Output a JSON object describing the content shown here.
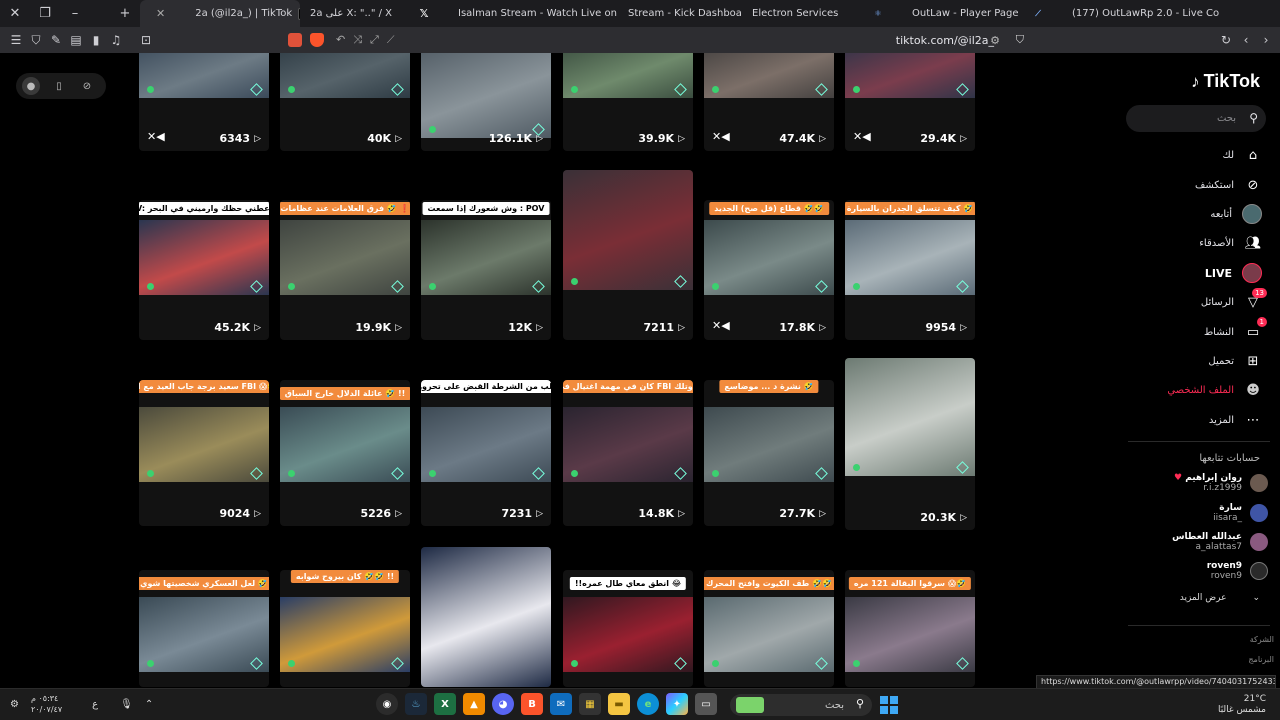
{
  "browser": {
    "tabs": [
      {
        "label": "2a (@il2a_) | TikTok",
        "favicon": "tiktok-icon",
        "active": true
      },
      {
        "label": "2a على X: \"..\" / X",
        "favicon": "x-icon",
        "active": false
      },
      {
        "label": "Isalman Stream - Watch Live on Kick",
        "favicon": "kick-icon",
        "active": false
      },
      {
        "label": "Stream - Kick Dashboard",
        "favicon": "kick-icon",
        "active": false
      },
      {
        "label": "Electron Services",
        "favicon": "electron-icon",
        "active": false
      },
      {
        "label": "OutLaw - Player Page",
        "favicon": "outlaw-icon",
        "active": false
      },
      {
        "label": "(177) OutLawRp 2.0 - Live Console",
        "favicon": "kick-icon",
        "active": false
      }
    ],
    "address": "tiktok.com/@il2a_",
    "status_url": "https://www.tiktok.com/@outlawrpp/video/7404031752433405192"
  },
  "sidebar": {
    "logo": "TikTok",
    "search_placeholder": "بحث",
    "nav": [
      {
        "label": "لك",
        "icon": "home-icon"
      },
      {
        "label": "استكشف",
        "icon": "compass-icon"
      },
      {
        "label": "أتابعه",
        "icon": "avatar-icon"
      },
      {
        "label": "الأصدقاء",
        "icon": "friends-icon"
      },
      {
        "label": "LIVE",
        "icon": "live-avatar-icon"
      },
      {
        "label": "الرسائل",
        "icon": "inbox-icon",
        "badge": "13"
      },
      {
        "label": "النشاط",
        "icon": "activity-icon",
        "badge": "1"
      },
      {
        "label": "تحميل",
        "icon": "upload-icon"
      },
      {
        "label": "الملف الشخصي",
        "icon": "profile-icon"
      },
      {
        "label": "المزيد",
        "icon": "more-icon"
      }
    ],
    "following_title": "حسابات تتابعها",
    "following": [
      {
        "name": "روان إبراهيم",
        "handle": "r.i.z1999",
        "heart": true
      },
      {
        "name": "سارة",
        "handle": "iisara_"
      },
      {
        "name": "عبدالله العطاس",
        "handle": "a_alattas7"
      },
      {
        "name": "roven9",
        "handle": "roven9"
      }
    ],
    "see_more": "عرض المزيد",
    "footer": [
      "الشركة",
      "البرنامج"
    ]
  },
  "videos": [
    {
      "views": "6343",
      "caption": "",
      "muted": true
    },
    {
      "views": "40K",
      "caption": ""
    },
    {
      "views": "126.1K",
      "caption": ""
    },
    {
      "views": "39.9K",
      "caption": ""
    },
    {
      "views": "47.4K",
      "caption": "",
      "muted": true
    },
    {
      "views": "29.4K",
      "caption": "",
      "muted": true
    },
    {
      "views": "45.2K",
      "caption": "POV: اعطني حظك وارميني في البحر 😂",
      "captionStyle": "white"
    },
    {
      "views": "19.9K",
      "caption": "فرق العلامات عند عظامات 🤣 ❗"
    },
    {
      "views": "12K",
      "caption": "وش شعورك إذا سمعت : POV",
      "captionStyle": "white"
    },
    {
      "views": "7211",
      "caption": ""
    },
    {
      "views": "17.8K",
      "caption": "قطاع (قل صح) الجديد 🤣🤣",
      "muted": true
    },
    {
      "views": "9954",
      "caption": "كيف تتسلق الجدران بالسيارة 🤣"
    },
    {
      "views": "9024",
      "caption": "سعيد برجة جاب العيد مع ال FBI 😱🤣"
    },
    {
      "views": "5226",
      "caption": "عائلة الدلال خارج السباق 🤣 !!"
    },
    {
      "views": "7231",
      "caption": "ال FBI تطلب من الشرطة القبض على تحرور !! 😱",
      "captionStyle": "white"
    },
    {
      "views": "14.8K",
      "caption": "كان في مهمة اغتيال في سجن FBI وتلك... 😱 !!"
    },
    {
      "views": "27.7K",
      "caption": "نشرة د ... موضاسع 🤣"
    },
    {
      "views": "20.3K",
      "caption": ""
    },
    {
      "views": "",
      "caption": "لعل العسكري شخصيتها شوي 🤣"
    },
    {
      "views": "",
      "caption": "كان بيروح شوابه 🤣🤣 !!"
    },
    {
      "views": "",
      "caption": ""
    },
    {
      "views": "",
      "caption": "!!انطق معاي طال عمره 😂",
      "captionStyle": "white"
    },
    {
      "views": "",
      "caption": "طف الكيوت وافتح المحرك 🤣🤣"
    },
    {
      "views": "",
      "caption": "سرقوا البقالة 121 مره 😱🤣"
    }
  ],
  "taskbar": {
    "time": "٠٥:٣٤ م",
    "date": "٢٠/٠٧/٤٧",
    "lang": "ع",
    "search_placeholder": "بحث",
    "temperature": "21°C",
    "weather": "مشمس غالبًا"
  }
}
